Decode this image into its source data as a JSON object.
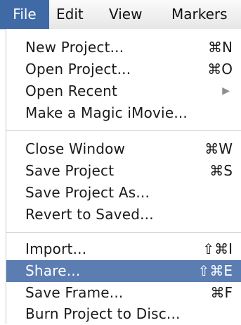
{
  "menubar": {
    "items": [
      {
        "label": "File"
      },
      {
        "label": "Edit"
      },
      {
        "label": "View"
      },
      {
        "label": "Markers"
      }
    ],
    "active_index": 0
  },
  "file_menu": {
    "items": [
      {
        "label": "New Project...",
        "shortcut": "⌘N"
      },
      {
        "label": "Open Project...",
        "shortcut": "⌘O"
      },
      {
        "label": "Open Recent",
        "submenu_icon": "triangle-right-icon",
        "submenu_glyph": "▶"
      },
      {
        "label": "Make a Magic iMovie..."
      },
      {
        "label": "Close Window",
        "shortcut": "⌘W"
      },
      {
        "label": "Save Project",
        "shortcut": "⌘S"
      },
      {
        "label": "Save Project As..."
      },
      {
        "label": "Revert to Saved..."
      },
      {
        "label": "Import...",
        "shortcut": "⇧⌘I"
      },
      {
        "label": "Share...",
        "shortcut": "⇧⌘E",
        "highlighted": true
      },
      {
        "label": "Save Frame...",
        "shortcut": "⌘F"
      },
      {
        "label": "Burn Project to Disc..."
      }
    ]
  },
  "colors": {
    "highlight": "#5b7db2",
    "active_menu_title": "#3f6aa5"
  }
}
